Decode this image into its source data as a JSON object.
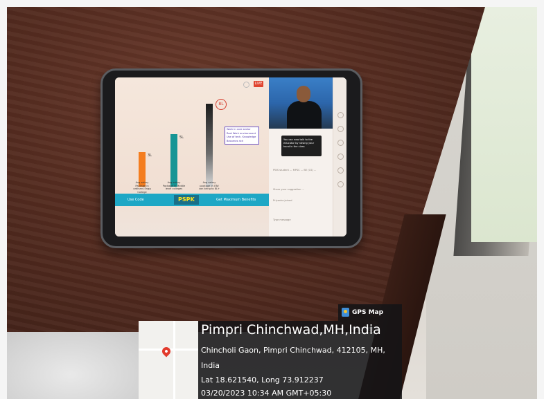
{
  "slide": {
    "bars": [
      {
        "label": "Avg salary Package in ordinary Engg College",
        "value": "3L",
        "color": "#f47d1f",
        "height": 0.42
      },
      {
        "label": "Avg salary Package in Middle level colleges",
        "value": "5L",
        "color": "#169595",
        "height": 0.63
      },
      {
        "label": "Avg salary package in IITs/ can bring to 8L+",
        "value": "8L",
        "color": "#1c1c1c",
        "height": 1.0
      }
    ],
    "legend": [
      "Work in core sector",
      "Real Work environment",
      "Use of tech. Knowledge",
      "Becomes rich"
    ],
    "banner": {
      "left": "Use Code",
      "code": "PSPK",
      "right": "Get Maximum Benefits"
    }
  },
  "chat": {
    "tooltip": [
      "You can now talk to the",
      "educator by raising your",
      "hand in the class"
    ],
    "lines": [
      "PWS student ... MPSC ... BE (CS) ...",
      "Share your suggestion ...",
      "Priyanka joined",
      "Type message"
    ]
  },
  "stamp": {
    "app": "GPS Map Camera",
    "title": "Pimpri Chinchwad,MH,India",
    "address": "Chincholi Gaon, Pimpri Chinchwad, 412105, MH,",
    "country": "India",
    "coords": "Lat 18.621540, Long 73.912237",
    "datetime": "03/20/2023 10:34 AM GMT+05:30"
  }
}
